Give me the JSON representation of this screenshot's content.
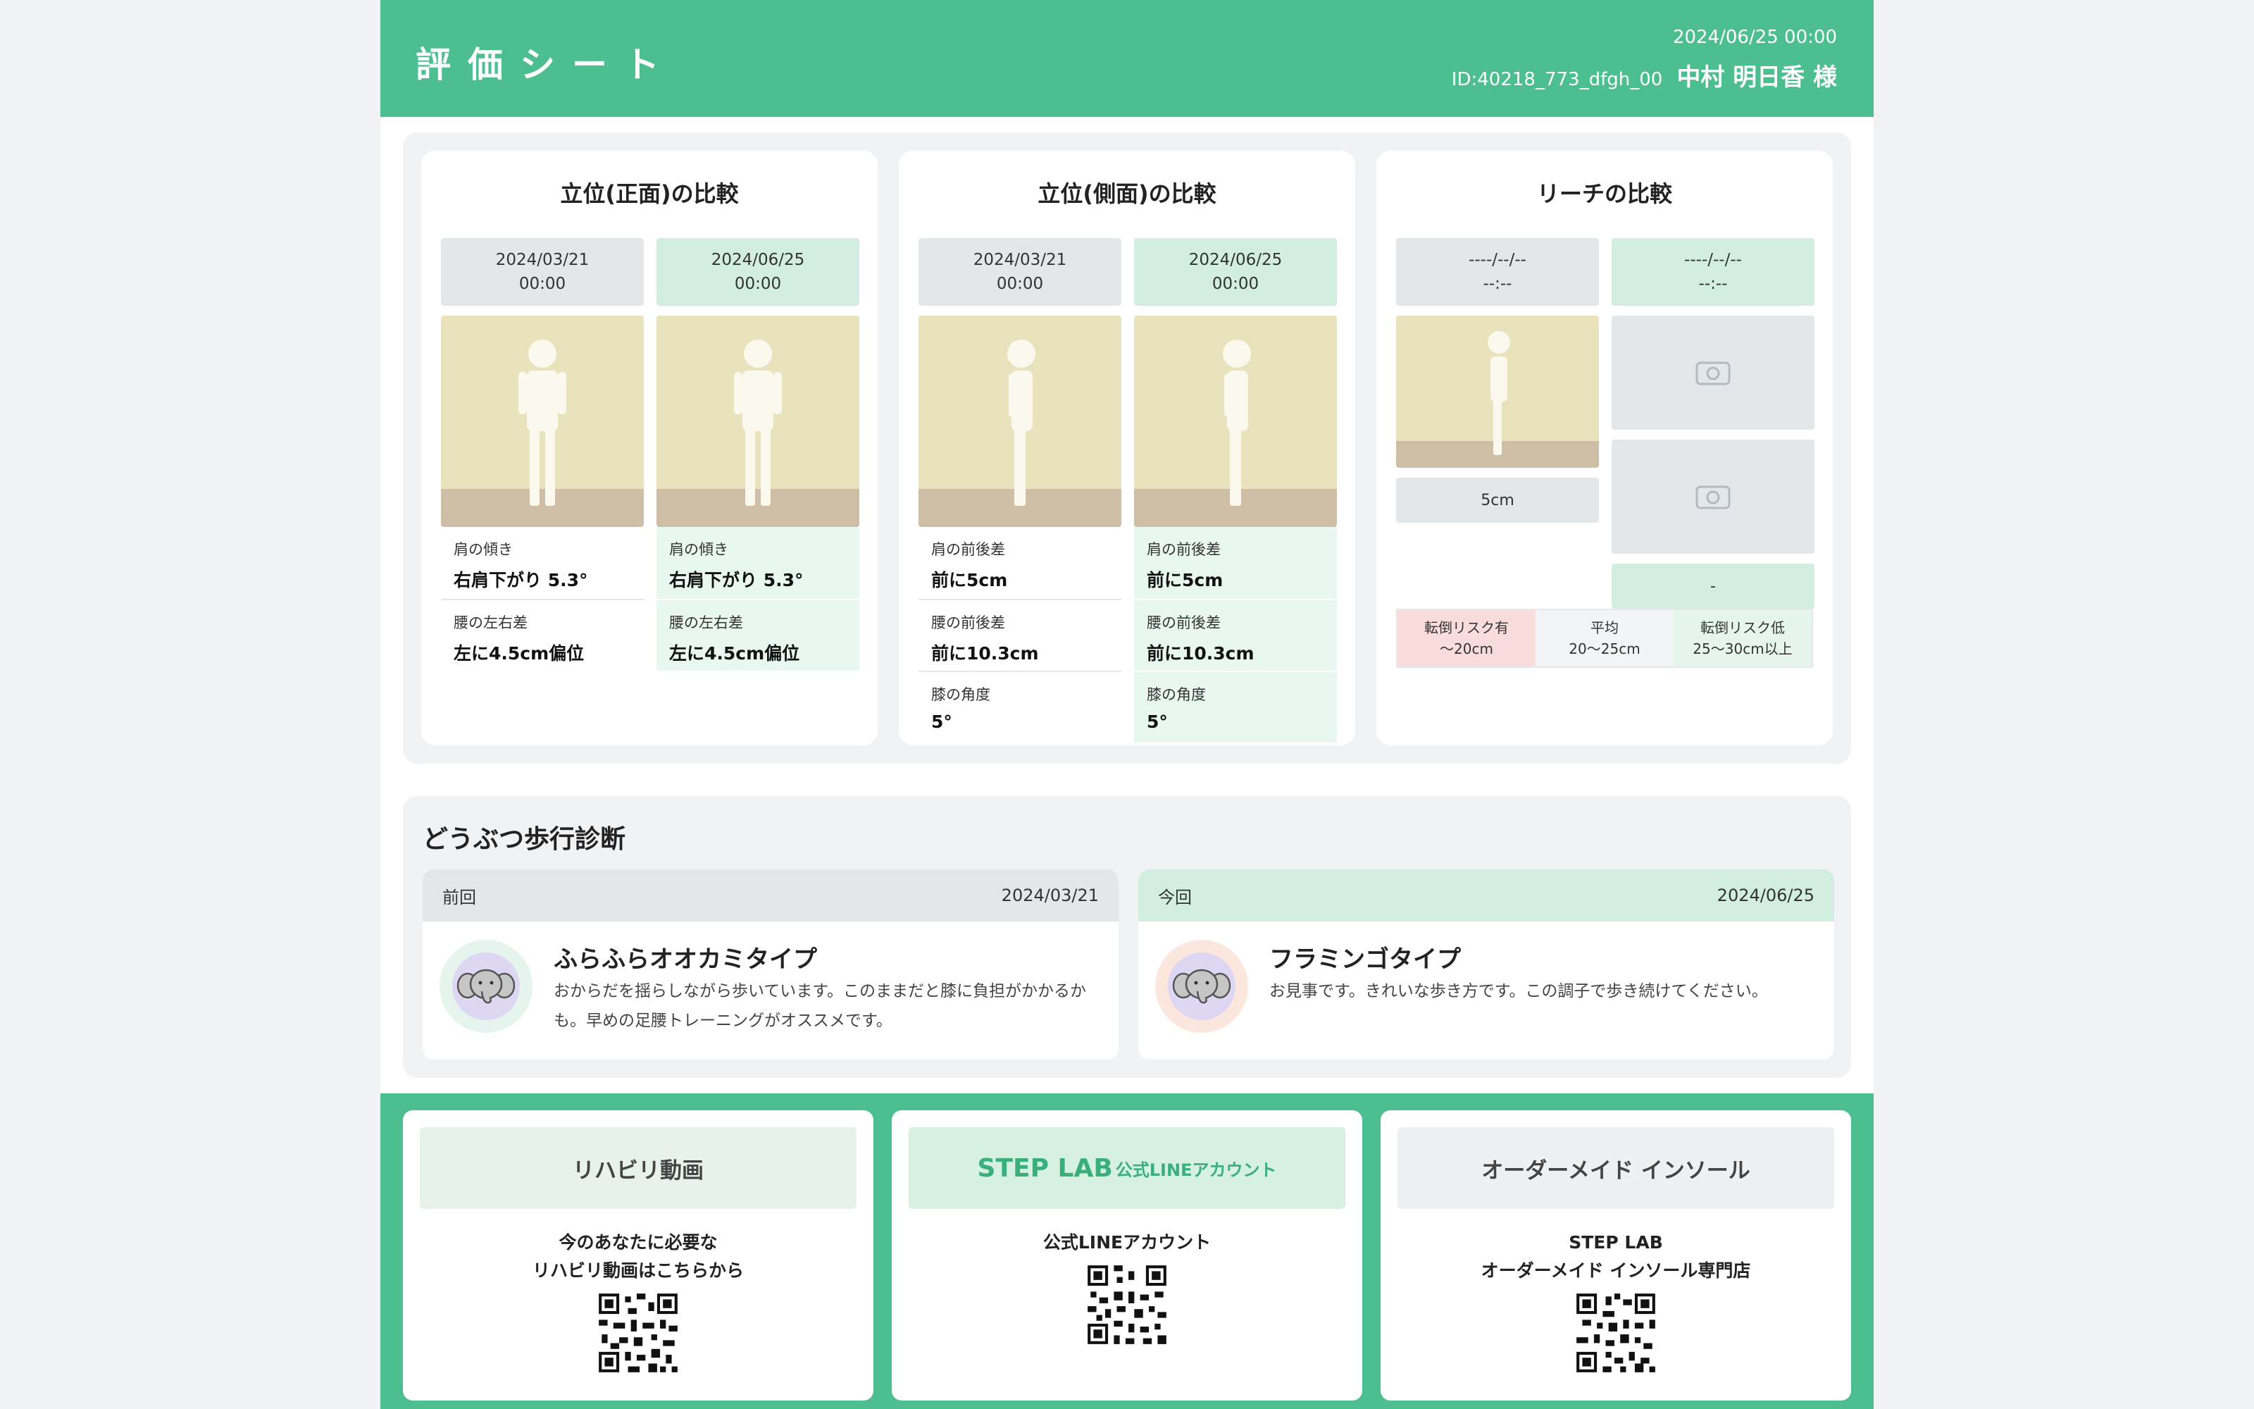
{
  "header": {
    "title": "評価シート",
    "datetime": "2024/06/25 00:00",
    "id": "ID:40218_773_dfgh_00",
    "patient": "中村 明日香 様"
  },
  "front": {
    "title": "立位(正面)の比較",
    "prev": {
      "date": "2024/03/21",
      "time": "00:00",
      "metrics": [
        {
          "label": "肩の傾き",
          "value": "右肩下がり 5.3°"
        },
        {
          "label": "腰の左右差",
          "value": "左に4.5cm偏位"
        }
      ]
    },
    "cur": {
      "date": "2024/06/25",
      "time": "00:00",
      "metrics": [
        {
          "label": "肩の傾き",
          "value": "右肩下がり 5.3°"
        },
        {
          "label": "腰の左右差",
          "value": "左に4.5cm偏位"
        }
      ]
    }
  },
  "side": {
    "title": "立位(側面)の比較",
    "prev": {
      "date": "2024/03/21",
      "time": "00:00",
      "metrics": [
        {
          "label": "肩の前後差",
          "value": "前に5cm"
        },
        {
          "label": "腰の前後差",
          "value": "前に10.3cm"
        },
        {
          "label": "膝の角度",
          "value": "5°"
        }
      ]
    },
    "cur": {
      "date": "2024/06/25",
      "time": "00:00",
      "metrics": [
        {
          "label": "肩の前後差",
          "value": "前に5cm"
        },
        {
          "label": "腰の前後差",
          "value": "前に10.3cm"
        },
        {
          "label": "膝の角度",
          "value": "5°"
        }
      ]
    }
  },
  "reach": {
    "title": "リーチの比較",
    "prev": {
      "date": "----/--/--",
      "time": "--:--",
      "value": "5cm"
    },
    "cur": {
      "date": "----/--/--",
      "time": "--:--",
      "value": "-"
    },
    "legend": {
      "risk": {
        "line1": "転倒リスク有",
        "line2": "〜20cm"
      },
      "avg": {
        "line1": "平均",
        "line2": "20〜25cm"
      },
      "low": {
        "line1": "転倒リスク低",
        "line2": "25〜30cm以上"
      }
    }
  },
  "walk": {
    "title": "どうぶつ歩行診断",
    "prev": {
      "label": "前回",
      "date": "2024/03/21",
      "animal": "ふらふらオオカミタイプ",
      "desc": "おからだを揺らしながら歩いています。このままだと膝に負担がかかるかも。早めの足腰トレーニングがオススメです。",
      "icon": "elephant-icon"
    },
    "cur": {
      "label": "今回",
      "date": "2024/06/25",
      "animal": "フラミンゴタイプ",
      "desc": "お見事です。きれいな歩き方です。この調子で歩き続けてください。",
      "icon": "elephant-icon"
    }
  },
  "footer": {
    "rehab": {
      "button": "リハビリ動画",
      "line1": "今のあなたに必要な",
      "line2": "リハビリ動画はこちらから"
    },
    "line": {
      "brand": "STEP LAB",
      "sub": "公式LINEアカウント",
      "line1": "公式LINEアカウント"
    },
    "insole": {
      "button": "オーダーメイド インソール",
      "line1": "STEP LAB",
      "line2": "オーダーメイド インソール専門店"
    }
  },
  "colors": {
    "accent": "#4cbe90",
    "current_bg": "#d2eee0",
    "previous_bg": "#e4e7ea",
    "risk_bg": "#f9dcdc"
  }
}
